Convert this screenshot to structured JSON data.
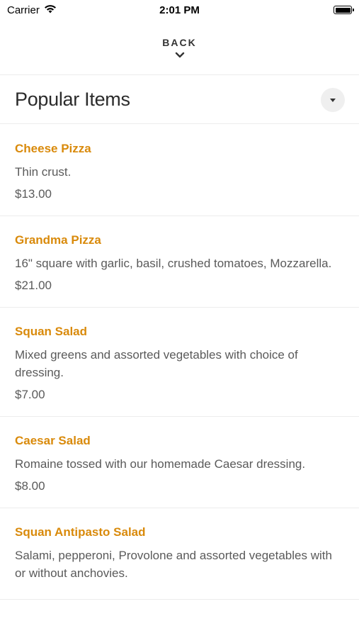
{
  "status_bar": {
    "carrier": "Carrier",
    "time": "2:01 PM"
  },
  "header": {
    "back_label": "BACK"
  },
  "section": {
    "title": "Popular Items"
  },
  "items": [
    {
      "name": "Cheese Pizza",
      "description": "Thin crust.",
      "price": "$13.00"
    },
    {
      "name": "Grandma Pizza",
      "description": "16\" square with garlic, basil, crushed tomatoes, Mozzarella.",
      "price": "$21.00"
    },
    {
      "name": "Squan Salad",
      "description": "Mixed greens and assorted vegetables with choice of dressing.",
      "price": "$7.00"
    },
    {
      "name": "Caesar Salad",
      "description": "Romaine tossed with our homemade Caesar dressing.",
      "price": "$8.00"
    },
    {
      "name": "Squan Antipasto Salad",
      "description": "Salami, pepperoni, Provolone and assorted vegetables with or without anchovies.",
      "price": ""
    }
  ],
  "colors": {
    "item_name": "#d98a0b",
    "text": "#5a5a5a",
    "divider": "#ececec"
  },
  "icons": [
    "wifi-icon",
    "battery-icon",
    "chevron-down-icon",
    "caret-down-icon"
  ]
}
